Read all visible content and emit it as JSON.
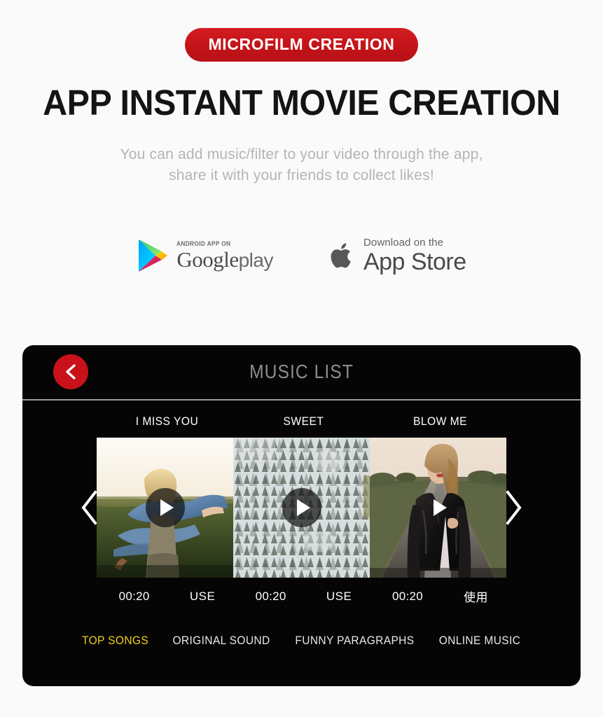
{
  "promo": {
    "ribbon_label": "MICROFILM CREATION",
    "headline": "APP INSTANT MOVIE CREATION",
    "subcopy_line1": "You can add music/filter to your video through the app,",
    "subcopy_line2": "share it with your friends to collect likes!",
    "ribbon_color": "#c4151a",
    "headline_color": "#141414",
    "subcopy_color": "#b4b4b4"
  },
  "stores": {
    "google_play": {
      "small_label": "ANDROID APP ON",
      "brand": "Google",
      "suffix": "play",
      "icon": "google-play-triangle-icon"
    },
    "app_store": {
      "small_label": "Download on the",
      "brand": "App Store",
      "icon": "apple-logo-icon"
    }
  },
  "app_panel": {
    "title": "MUSIC LIST",
    "title_color": "#8e8e8e",
    "background_color": "#050505",
    "back_button": {
      "icon": "chevron-left-icon",
      "color": "#c9111a"
    },
    "prev_arrow_icon": "chevron-left-icon",
    "next_arrow_icon": "chevron-right-icon",
    "tracks": [
      {
        "title": "I MISS YOU",
        "duration": "00:20",
        "action_label": "USE",
        "play_icon": "play-icon",
        "play_style": "circle",
        "thumbnail": "woman-denim-jacket-in-field-at-sunset"
      },
      {
        "title": "SWEET",
        "duration": "00:20",
        "action_label": "USE",
        "play_icon": "play-icon",
        "play_style": "circle",
        "thumbnail": "aerial-snow-covered-pine-forest"
      },
      {
        "title": "BLOW ME",
        "duration": "00:20",
        "action_label": "使用",
        "play_icon": "play-icon",
        "play_style": "bare",
        "thumbnail": "woman-leather-jacket-on-empty-road"
      }
    ],
    "tabs": [
      {
        "label": "TOP SONGS",
        "active": true
      },
      {
        "label": "ORIGINAL SOUND",
        "active": false
      },
      {
        "label": "FUNNY PARAGRAPHS",
        "active": false
      },
      {
        "label": "ONLINE MUSIC",
        "active": false
      }
    ],
    "active_tab_color": "#f2d018"
  }
}
